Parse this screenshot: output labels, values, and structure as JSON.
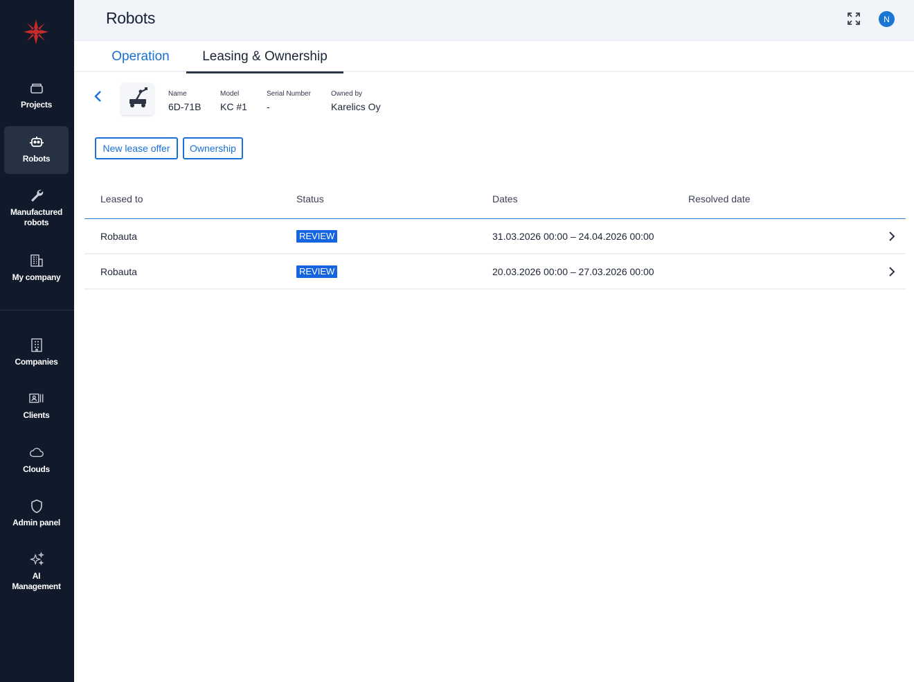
{
  "header": {
    "title": "Robots",
    "avatar_initial": "N"
  },
  "sidebar": {
    "items": [
      {
        "label": "Projects",
        "icon": "folder-icon"
      },
      {
        "label": "Robots",
        "icon": "robot-icon",
        "active": true
      },
      {
        "label": "Manufactured robots",
        "icon": "wrench-icon"
      },
      {
        "label": "My company",
        "icon": "building-icon"
      },
      {
        "label": "Companies",
        "icon": "office-building-icon"
      },
      {
        "label": "Clients",
        "icon": "contacts-icon"
      },
      {
        "label": "Clouds",
        "icon": "cloud-icon"
      },
      {
        "label": "Admin panel",
        "icon": "shield-icon"
      },
      {
        "label": "AI Management",
        "icon": "sparkles-icon"
      }
    ]
  },
  "tabs": [
    {
      "label": "Operation",
      "active": false
    },
    {
      "label": "Leasing & Ownership",
      "active": true
    }
  ],
  "robot": {
    "name_label": "Name",
    "name": "6D-71B",
    "model_label": "Model",
    "model": "KC #1",
    "serial_label": "Serial Number",
    "serial": "-",
    "owner_label": "Owned by",
    "owner": "Karelics Oy"
  },
  "actions": {
    "new_lease": "New lease offer",
    "ownership": "Ownership"
  },
  "table": {
    "headers": [
      "Leased to",
      "Status",
      "Dates",
      "Resolved date"
    ],
    "rows": [
      {
        "leased_to": "Robauta",
        "status": "REVIEW",
        "dates": "31.03.2026 00:00 – 24.04.2026 00:00",
        "resolved": ""
      },
      {
        "leased_to": "Robauta",
        "status": "REVIEW",
        "dates": "20.03.2026 00:00 – 27.03.2026 00:00",
        "resolved": ""
      }
    ]
  },
  "colors": {
    "sidebar_bg": "#111a2b",
    "accent": "#1a6fd6",
    "badge": "#1565e0"
  }
}
